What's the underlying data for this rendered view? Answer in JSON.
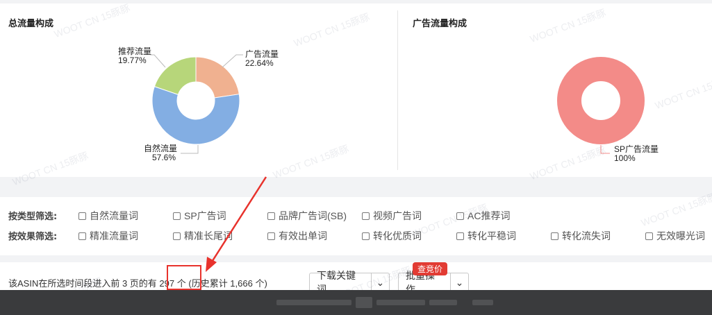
{
  "charts": {
    "total": {
      "title": "总流量构成",
      "slices": [
        {
          "name": "广告流量",
          "pct_label": "22.64%",
          "value": 22.64,
          "color": "#f0b190"
        },
        {
          "name": "自然流量",
          "pct_label": "57.6%",
          "value": 57.6,
          "color": "#83aee3"
        },
        {
          "name": "推荐流量",
          "pct_label": "19.77%",
          "value": 19.77,
          "color": "#b7d67a"
        }
      ]
    },
    "ad": {
      "title": "广告流量构成",
      "slices": [
        {
          "name": "SP广告流量",
          "pct_label": "100%",
          "value": 100,
          "color": "#f38b88"
        }
      ]
    }
  },
  "watermark_text": "WOOT CN 15豚豚",
  "filters": {
    "type_label": "按类型筛选:",
    "type_options": [
      "自然流量词",
      "SP广告词",
      "品牌广告词(SB)",
      "视频广告词",
      "AC推荐词"
    ],
    "effect_label": "按效果筛选:",
    "effect_options": [
      "精准流量词",
      "精准长尾词",
      "有效出单词",
      "转化优质词",
      "转化平稳词",
      "转化流失词",
      "无效曝光词"
    ]
  },
  "summary": {
    "prefix": "该ASIN在所选时间段进入前 3 页的有",
    "count": "297 个",
    "history": "(历史累计 1,666 个)",
    "download_label": "下载关键词",
    "batch_label": "批量操作",
    "badge_label": "查竞价",
    "caret": "⌄"
  }
}
